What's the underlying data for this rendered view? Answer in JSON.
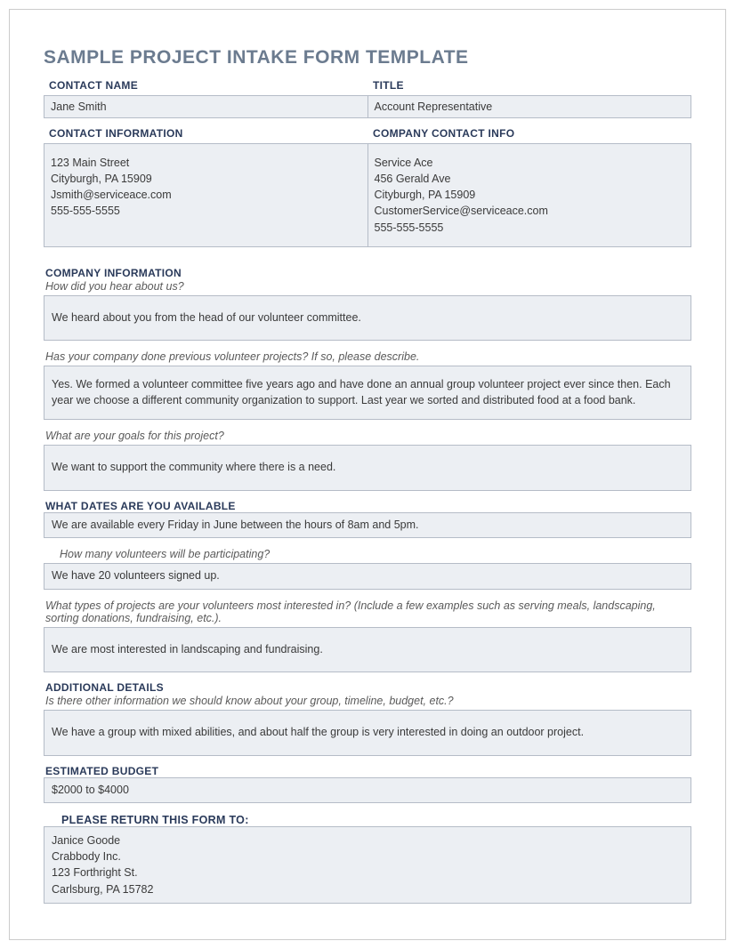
{
  "title": "SAMPLE PROJECT INTAKE FORM TEMPLATE",
  "labels": {
    "contactName": "CONTACT NAME",
    "title": "TITLE",
    "contactInfo": "CONTACT INFORMATION",
    "companyContact": "COMPANY CONTACT INFO",
    "companyInfo": "COMPANY INFORMATION",
    "dates": "WHAT DATES ARE YOU AVAILABLE",
    "additional": "ADDITIONAL DETAILS",
    "budget": "ESTIMATED BUDGET",
    "returnTo": "PLEASE RETURN THIS FORM TO:"
  },
  "contact": {
    "name": "Jane Smith",
    "title": "Account Representative",
    "info": "123 Main Street\nCityburgh, PA 15909\nJsmith@serviceace.com\n555-555-5555",
    "companyInfo": "Service Ace\n456 Gerald Ave\nCityburgh, PA 15909\nCustomerService@serviceace.com\n555-555-5555"
  },
  "prompts": {
    "heard": "How did you hear about us?",
    "previous": "Has your company done previous volunteer projects? If so, please describe.",
    "goals": "What are your goals for this project?",
    "volunteers": "How many volunteers will be participating?",
    "interests": "What types of projects are your volunteers most interested in? (Include a few examples such as serving meals, landscaping, sorting donations, fundraising, etc.).",
    "other": "Is there other information we should know about your group, timeline, budget, etc.?"
  },
  "answers": {
    "heard": "We heard about you from the head of our volunteer committee.",
    "previous": "Yes. We formed a volunteer committee five years ago and have done an annual group volunteer project ever since then. Each year we choose a different community organization to support. Last year we sorted and distributed food at a food bank.",
    "goals": "We want to support the community where there is a need.",
    "dates": "We are available every Friday in June between the hours of 8am and 5pm.",
    "volunteers": "We have 20 volunteers signed up.",
    "interests": "We are most interested in landscaping and fundraising.",
    "other": "We have a group with mixed abilities, and about half the group is very interested in doing an outdoor project.",
    "budget": "$2000 to $4000"
  },
  "returnTo": "Janice Goode\nCrabbody Inc.\n123 Forthright St.\nCarlsburg, PA 15782"
}
